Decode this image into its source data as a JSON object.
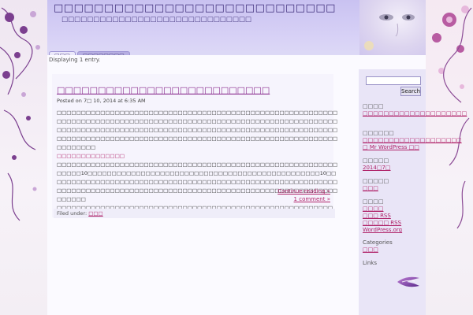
{
  "header": {
    "title": "□□□□□□□□□□□□□□□□□□□□□□□□□□□□",
    "description": "□□□□□□□□□□□□□□□□□□□□□□□□□□□□□□"
  },
  "tabs": [
    {
      "label": "□□□"
    },
    {
      "label": "□□□□□□□□"
    }
  ],
  "displaying": "Displaying 1 entry.",
  "post": {
    "title": "□□□□□□□□□□□□□□□□□□□□□□□□□□",
    "meta": "Posted on 7□ 10, 2014 at 6:35 AM",
    "paragraphs": [
      "□□□□□□□□□□□□□□□□□□□□□□□□□□□□□□□□□□□□□□□□□□□□□□□□□□□□□□□□□□□□□□□□□□□□□□□□□□□□□□□□□□□□□□□□□□□□□□□□□□□□□□□□□□□□□□□□□□□□□□□□□□□□□□□□□□□□□□□□□□□□□□□□□□□□□□□□□□□□□□□□□□□□□□□□□□□□□□□□□□□□□□□□□□□□□□□□□□□□□□□□□□□□□□□□□□□□□□□□□□□□□□□□□□□□□□□□□□□□□□□□",
      "□□□□□□□□□□□□□□",
      "□□□□□□□□□□□□□□□□□□□□□□□□□□□□□□□□□□□□□□□□□□□□□□□□□□□□□□□□□□□□□□□10□□□□□□□□□□□□□□□□□□□□□□□□□□□□□□□□□□□□□□□□□□□□□□□□10□□□□□□□□□□□□□□□□□□□□□□□□□□□□□□□□□□□□□□□□□□□□□□□□□□□□□□□□□□□□□□□□□□□□□□□□□□□□□□□□□□□□□□□□□□□□□□□□□□□□□□□□□□□□□□□□□□□□□□□□□□□□",
      "□□□□□□□□□□□□□□□□□□□□□□□□□□□□□□□□□□□□□□□□□□□□□□□□□□□□□□□□□"
    ],
    "continue_reading": "Continue reading »",
    "comments": "1 comment »",
    "filed_label": "Filed under:",
    "filed_category": "□□□"
  },
  "sidebar": {
    "search_placeholder": "",
    "search_button": "Search",
    "widgets": [
      {
        "title": "□□□□",
        "links": [
          "□□□□□□□□□□□□□□□□□□□□"
        ]
      },
      {
        "title": "□□□□□□",
        "links": [
          "□□□□□□□□□□□□□□□□□□□",
          "□ Mr WordPress □□"
        ]
      },
      {
        "title": "□□□□□",
        "links": [
          "2014□7□"
        ]
      },
      {
        "title": "□□□□□",
        "links": [
          "□□□"
        ]
      },
      {
        "title": "□□□□",
        "links": [
          "□□□□",
          "□□□ RSS",
          "□□□□□ RSS",
          "WordPress.org"
        ]
      },
      {
        "title": "Categories",
        "links": [
          "□□□"
        ]
      },
      {
        "title": "Links",
        "links": []
      }
    ]
  },
  "colors": {
    "header_bg": "#c9c2f1",
    "link": "#b0246a",
    "title": "#3e2d7a",
    "post_title": "#8a2d8f"
  },
  "icons": {
    "logo": "swoosh-logo-icon",
    "floral_left": "floral-decoration-icon",
    "floral_right": "floral-decoration-icon"
  }
}
